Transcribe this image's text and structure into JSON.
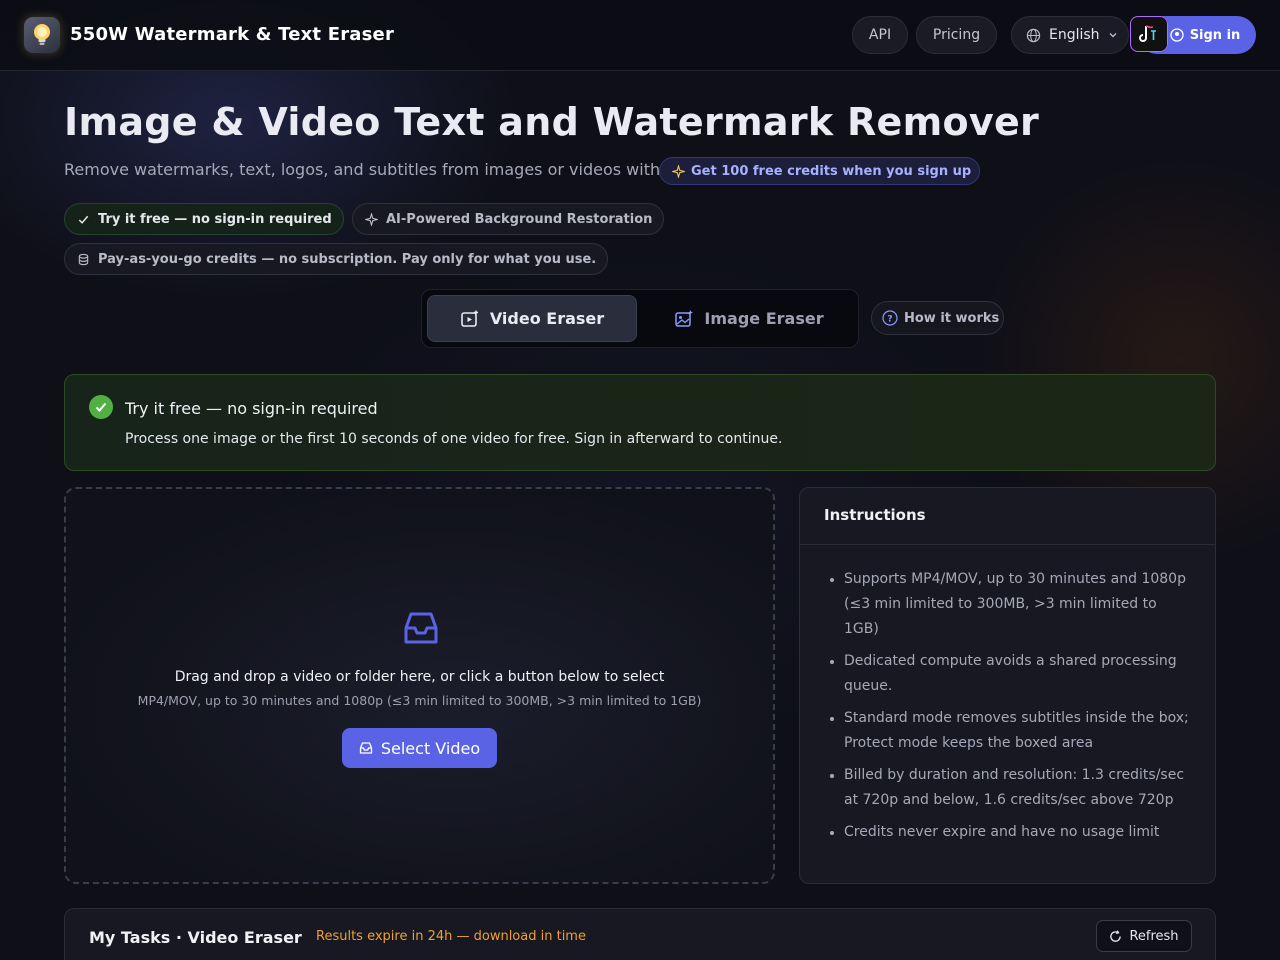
{
  "header": {
    "brand": "550W Watermark & Text Eraser",
    "nav": {
      "api": "API",
      "pricing": "Pricing",
      "language": "English",
      "sign_in": "Sign in"
    }
  },
  "hero": {
    "title": "Image & Video Text and Watermark Remover",
    "subtitle": "Remove watermarks, text, logos, and subtitles from images or videos with AI.",
    "credits_offer": "Get 100 free credits when you sign up",
    "chips": {
      "free": "Try it free — no sign-in required",
      "ai": "AI-Powered Background Restoration",
      "payg": "Pay-as-you-go credits — no subscription. Pay only for what you use."
    }
  },
  "tabs": {
    "video": "Video Eraser",
    "image": "Image Eraser",
    "active": "video",
    "how_it_works": "How it works"
  },
  "free_banner": {
    "title": "Try it free — no sign-in required",
    "description": "Process one image or the first 10 seconds of one video for free. Sign in afterward to continue."
  },
  "dropzone": {
    "main_text": "Drag and drop a video or folder here, or click a button below to select",
    "sub_text": "MP4/MOV, up to 30 minutes and 1080p (≤3 min limited to 300MB, >3 min limited to 1GB)",
    "button": "Select Video"
  },
  "instructions": {
    "title": "Instructions",
    "items": [
      "Supports MP4/MOV, up to 30 minutes and 1080p (≤3 min limited to 300MB, >3 min limited to 1GB)",
      "Dedicated compute avoids a shared processing queue.",
      "Standard mode removes subtitles inside the box; Protect mode keeps the boxed area",
      "Billed by duration and resolution: 1.3 credits/sec at 720p and below, 1.6 credits/sec above 720p",
      "Credits never expire and have no usage limit"
    ]
  },
  "tasks": {
    "title": "My Tasks · Video Eraser",
    "note": "Results expire in 24h — download in time",
    "refresh": "Refresh"
  },
  "colors": {
    "accent": "#5a63e6",
    "success": "#52b043",
    "warning": "#f0a030",
    "background": "#0e0f17"
  }
}
